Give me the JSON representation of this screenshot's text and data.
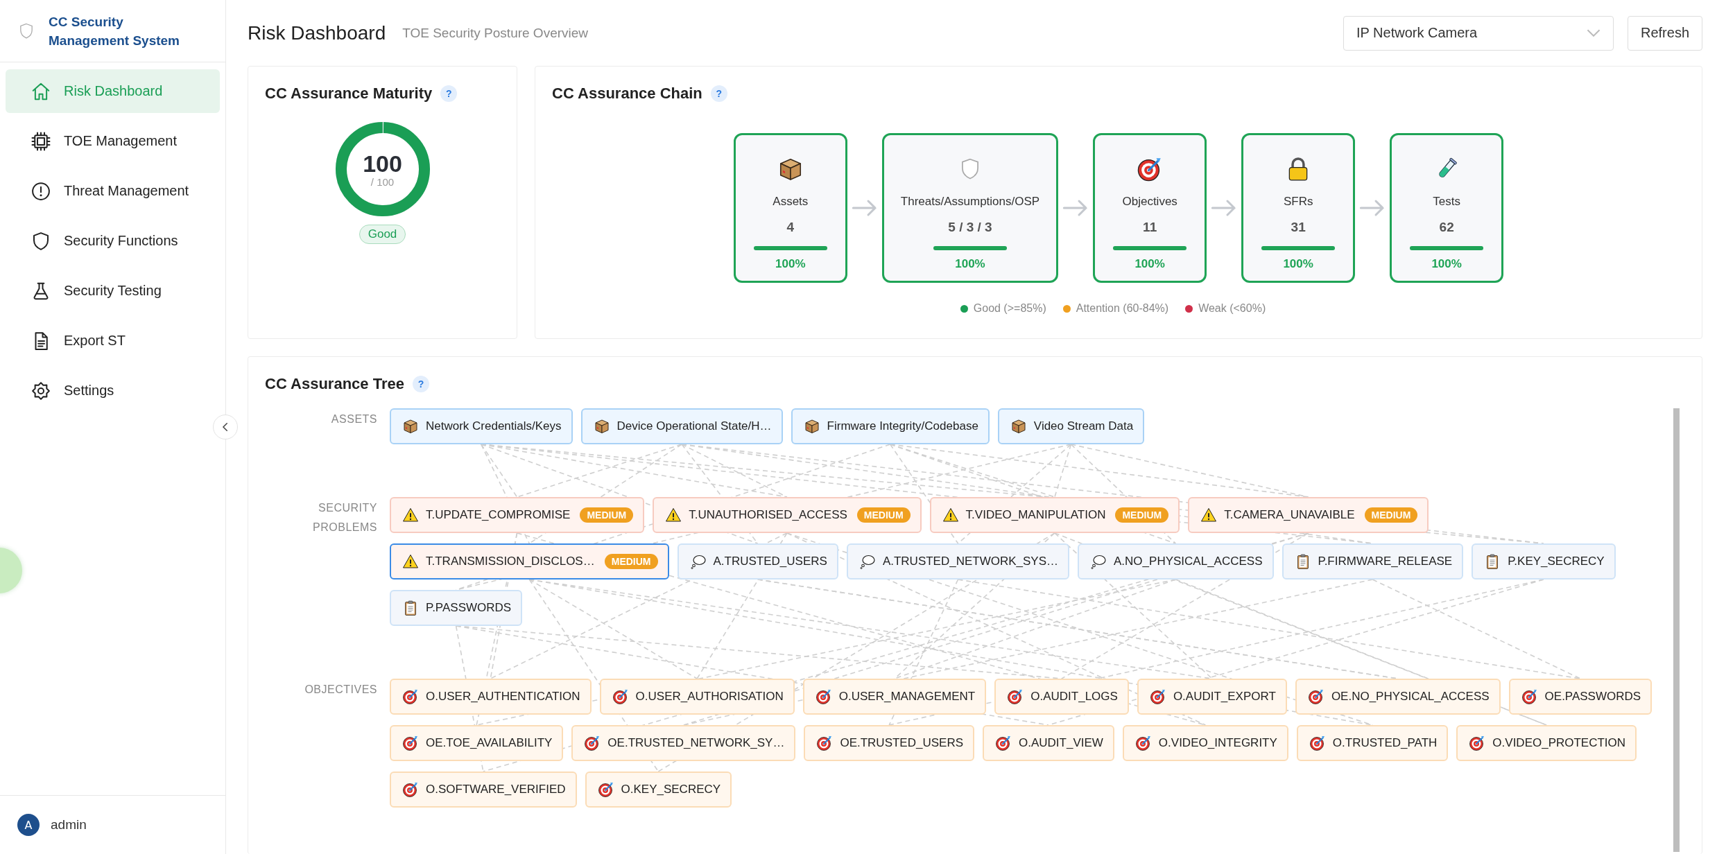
{
  "sidebar": {
    "logo_title": "CC Security Management System",
    "items": [
      {
        "label": "Risk Dashboard",
        "selected": true
      },
      {
        "label": "TOE Management",
        "selected": false
      },
      {
        "label": "Threat Management",
        "selected": false
      },
      {
        "label": "Security Functions",
        "selected": false
      },
      {
        "label": "Security Testing",
        "selected": false
      },
      {
        "label": "Export ST",
        "selected": false
      },
      {
        "label": "Settings",
        "selected": false
      }
    ],
    "user": {
      "avatar": "A",
      "name": "admin"
    }
  },
  "header": {
    "title": "Risk Dashboard",
    "subtitle": "TOE Security Posture Overview",
    "toe_select": {
      "value": "IP Network Camera"
    },
    "refresh_button": "Refresh"
  },
  "maturity": {
    "title": "CC Assurance Maturity",
    "help": "?",
    "score": "100",
    "max": "/ 100",
    "level": 1,
    "rating": "Good"
  },
  "chain": {
    "title": "CC Assurance Chain",
    "help": "?",
    "stages": [
      {
        "label": "Assets",
        "value": "4",
        "level": 1,
        "percent": "100%"
      },
      {
        "label": "Threats/Assumptions/OSP",
        "value": "5 / 3 / 3",
        "level": 1,
        "percent": "100%"
      },
      {
        "label": "Objectives",
        "value": "11",
        "level": 1,
        "percent": "100%"
      },
      {
        "label": "SFRs",
        "value": "31",
        "level": 1,
        "percent": "100%"
      },
      {
        "label": "Tests",
        "value": "62",
        "level": 1,
        "percent": "100%"
      }
    ],
    "legend": [
      {
        "label": "Good (>=85%)",
        "color": "#1a9e55"
      },
      {
        "label": "Attention (60-84%)",
        "color": "#f0a020"
      },
      {
        "label": "Weak (<60%)",
        "color": "#d0304a"
      }
    ]
  },
  "tree": {
    "title": "CC Assurance Tree",
    "help": "?",
    "groups": [
      {
        "label": "ASSETS",
        "nodes": [
          {
            "kind": "asset",
            "label": "Network Credentials/Keys",
            "selected": false
          },
          {
            "kind": "asset",
            "label": "Device Operational State/H…",
            "selected": false
          },
          {
            "kind": "asset",
            "label": "Firmware Integrity/Codebase",
            "selected": false
          },
          {
            "kind": "asset",
            "label": "Video Stream Data",
            "selected": false
          }
        ]
      },
      {
        "label": "SECURITY PROBLEMS",
        "nodes": [
          {
            "kind": "threat",
            "label": "T.UPDATE_COMPROMISE",
            "badge": "MEDIUM",
            "selected": false
          },
          {
            "kind": "threat",
            "label": "T.UNAUTHORISED_ACCESS",
            "badge": "MEDIUM",
            "selected": false
          },
          {
            "kind": "threat",
            "label": "T.VIDEO_MANIPULATION",
            "badge": "MEDIUM",
            "selected": false
          },
          {
            "kind": "threat",
            "label": "T.CAMERA_UNAVAIBLE",
            "badge": "MEDIUM",
            "selected": false
          },
          {
            "kind": "threat",
            "label": "T.TRANSMISSION_DISCLOS…",
            "badge": "MEDIUM",
            "selected": true
          },
          {
            "kind": "assumption",
            "label": "A.TRUSTED_USERS",
            "selected": false
          },
          {
            "kind": "assumption",
            "label": "A.TRUSTED_NETWORK_SYS…",
            "selected": false
          },
          {
            "kind": "assumption",
            "label": "A.NO_PHYSICAL_ACCESS",
            "selected": false
          },
          {
            "kind": "policy",
            "label": "P.FIRMWARE_RELEASE",
            "selected": false
          },
          {
            "kind": "policy",
            "label": "P.KEY_SECRECY",
            "selected": false
          },
          {
            "kind": "policy",
            "label": "P.PASSWORDS",
            "selected": false
          }
        ]
      },
      {
        "label": "OBJECTIVES",
        "nodes": [
          {
            "kind": "objective",
            "label": "O.USER_AUTHENTICATION",
            "selected": false
          },
          {
            "kind": "objective",
            "label": "O.USER_AUTHORISATION",
            "selected": false
          },
          {
            "kind": "objective",
            "label": "O.USER_MANAGEMENT",
            "selected": false
          },
          {
            "kind": "objective",
            "label": "O.AUDIT_LOGS",
            "selected": false
          },
          {
            "kind": "objective",
            "label": "O.AUDIT_EXPORT",
            "selected": false
          },
          {
            "kind": "objective",
            "label": "OE.NO_PHYSICAL_ACCESS",
            "selected": false
          },
          {
            "kind": "objective",
            "label": "OE.PASSWORDS",
            "selected": false
          },
          {
            "kind": "objective",
            "label": "OE.TOE_AVAILABILITY",
            "selected": false
          },
          {
            "kind": "objective",
            "label": "OE.TRUSTED_NETWORK_SY…",
            "selected": false
          },
          {
            "kind": "objective",
            "label": "OE.TRUSTED_USERS",
            "selected": false
          },
          {
            "kind": "objective",
            "label": "O.AUDIT_VIEW",
            "selected": false
          },
          {
            "kind": "objective",
            "label": "O.VIDEO_INTEGRITY",
            "selected": false
          },
          {
            "kind": "objective",
            "label": "O.TRUSTED_PATH",
            "selected": false
          },
          {
            "kind": "objective",
            "label": "O.VIDEO_PROTECTION",
            "selected": false
          },
          {
            "kind": "objective",
            "label": "O.SOFTWARE_VERIFIED",
            "selected": false
          },
          {
            "kind": "objective",
            "label": "O.KEY_SECRECY",
            "selected": false
          }
        ]
      }
    ]
  }
}
